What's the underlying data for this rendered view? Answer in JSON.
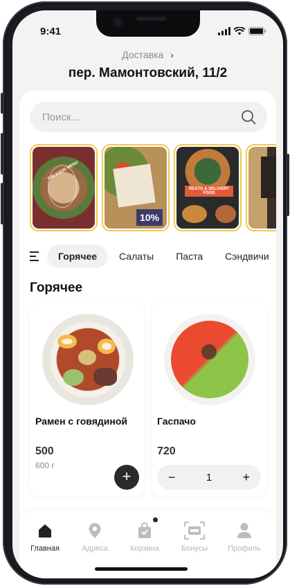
{
  "status_bar": {
    "time": "9:41"
  },
  "header": {
    "delivery_label": "Доставка",
    "address": "пер. Мамонтовский, 11/2"
  },
  "search": {
    "placeholder": "Поиск..."
  },
  "stories": [
    {
      "name": "story-1",
      "text": "THE FOOD MENU"
    },
    {
      "name": "story-2",
      "text": "10%"
    },
    {
      "name": "story-3",
      "text": "RESTO & DELIVERY FOOD"
    },
    {
      "name": "story-4",
      "text": ""
    }
  ],
  "categories": [
    "Горячее",
    "Салаты",
    "Паста",
    "Сэндвичи"
  ],
  "active_category": "Горячее",
  "section_title": "Горячее",
  "products": [
    {
      "name": "Рамен с говядиной",
      "price": "500",
      "weight": "600 г",
      "action": "+"
    },
    {
      "name": "Гаспачо",
      "price": "720",
      "quantity": "1",
      "minus": "−",
      "plus": "+"
    }
  ],
  "tabbar": [
    {
      "label": "Главная",
      "icon": "home-icon",
      "active": true
    },
    {
      "label": "Адреса",
      "icon": "location-pin-icon",
      "active": false
    },
    {
      "label": "Корзина",
      "icon": "cart-bag-icon",
      "active": false
    },
    {
      "label": "Бонусы",
      "icon": "bonus-card-icon",
      "active": false
    },
    {
      "label": "Профиль",
      "icon": "profile-icon",
      "active": false
    }
  ],
  "colors": {
    "accent": "#f2c94c",
    "dark": "#2a2a2a",
    "background": "#f3f3f3"
  }
}
